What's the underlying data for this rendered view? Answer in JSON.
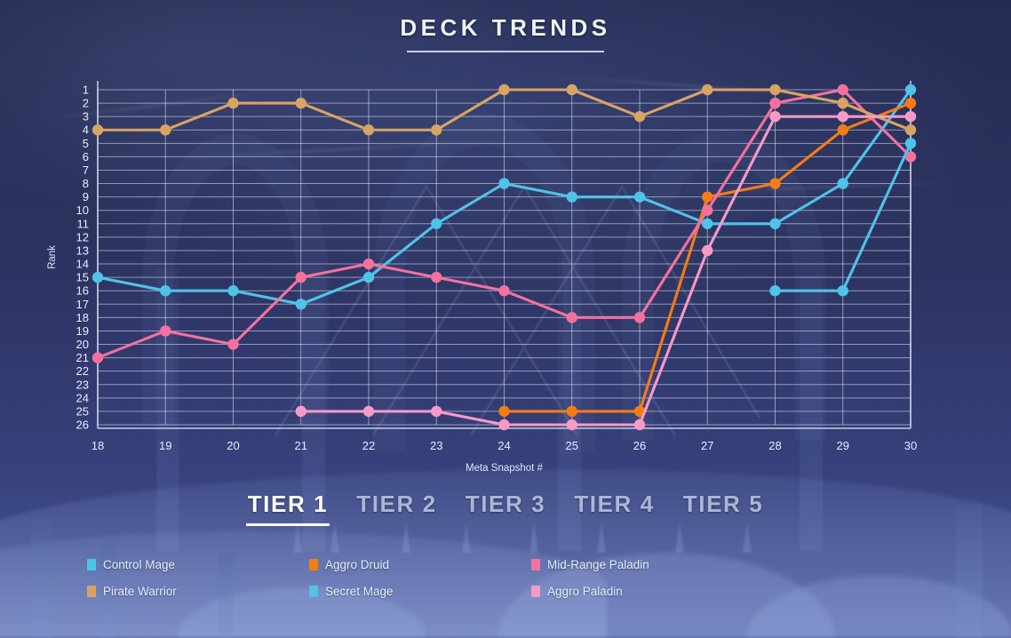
{
  "header": {
    "title": "DECK TRENDS"
  },
  "tiers": {
    "active_index": 0,
    "tabs": [
      {
        "label": "TIER 1"
      },
      {
        "label": "TIER 2"
      },
      {
        "label": "TIER 3"
      },
      {
        "label": "TIER 4"
      },
      {
        "label": "TIER 5"
      }
    ]
  },
  "colors": {
    "control_mage": "#4fc3e8",
    "secret_mage": "#4fc3e8",
    "aggro_druid": "#f57c12",
    "mid_range_paladin": "#f4719e",
    "pirate_warrior": "#d9a363",
    "aggro_paladin": "#f79ac8",
    "background": "#252b52",
    "grid": "#e1e9fa",
    "text": "#e9eefb",
    "accent": "#ffffff"
  },
  "legend": {
    "items": [
      {
        "label": "Control Mage",
        "color": "#4fc3e8"
      },
      {
        "label": "Aggro Druid",
        "color": "#f57c12"
      },
      {
        "label": "Mid-Range Paladin",
        "color": "#f4719e"
      },
      {
        "label": "Pirate Warrior",
        "color": "#d9a363"
      },
      {
        "label": "Secret Mage",
        "color": "#4fc3e8"
      },
      {
        "label": "Aggro Paladin",
        "color": "#f79ac8"
      }
    ]
  },
  "chart_data": {
    "type": "line",
    "title": "DECK TRENDS",
    "xlabel": "Meta Snapshot #",
    "ylabel": "Rank",
    "x": [
      18,
      19,
      20,
      21,
      22,
      23,
      24,
      25,
      26,
      27,
      28,
      29,
      30
    ],
    "xlim": [
      18,
      30
    ],
    "ylim": [
      1,
      26
    ],
    "y_inverted": true,
    "y_ticks": [
      1,
      2,
      3,
      4,
      5,
      6,
      7,
      8,
      9,
      10,
      11,
      12,
      13,
      14,
      15,
      16,
      17,
      18,
      19,
      20,
      21,
      22,
      23,
      24,
      25,
      26
    ],
    "x_ticks": [
      18,
      19,
      20,
      21,
      22,
      23,
      24,
      25,
      26,
      27,
      28,
      29,
      30
    ],
    "grid": true,
    "legend_position": "bottom",
    "series": [
      {
        "name": "Control Mage",
        "color": "#4fc3e8",
        "values": [
          15,
          16,
          16,
          17,
          15,
          11,
          8,
          9,
          9,
          11,
          11,
          8,
          1
        ]
      },
      {
        "name": "Aggro Druid",
        "color": "#f57c12",
        "values": [
          null,
          null,
          null,
          null,
          null,
          null,
          25,
          25,
          25,
          9,
          8,
          4,
          2
        ]
      },
      {
        "name": "Mid-Range Paladin",
        "color": "#f4719e",
        "values": [
          21,
          19,
          20,
          15,
          14,
          15,
          16,
          18,
          18,
          10,
          2,
          1,
          6
        ]
      },
      {
        "name": "Pirate Warrior",
        "color": "#d9a363",
        "values": [
          4,
          4,
          2,
          2,
          4,
          4,
          1,
          1,
          3,
          1,
          1,
          2,
          4
        ]
      },
      {
        "name": "Secret Mage",
        "color": "#4fc3e8",
        "values": [
          null,
          null,
          null,
          null,
          null,
          null,
          null,
          null,
          null,
          null,
          16,
          16,
          5
        ]
      },
      {
        "name": "Aggro Paladin",
        "color": "#f79ac8",
        "values": [
          null,
          null,
          null,
          25,
          25,
          25,
          26,
          26,
          26,
          13,
          3,
          3,
          3
        ]
      }
    ]
  }
}
